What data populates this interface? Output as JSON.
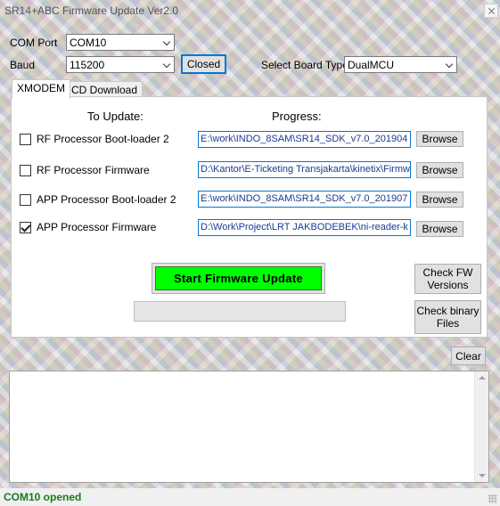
{
  "window": {
    "title": "SR14+ABC Firmware Update Ver2.0"
  },
  "connection": {
    "com_port_label": "COM Port",
    "com_port_value": "COM10",
    "baud_label": "Baud",
    "baud_value": "115200",
    "port_button_label": "Closed",
    "board_type_label": "Select Board Type",
    "board_type_value": "DualMCU"
  },
  "tabs": [
    {
      "label": "XMODEM",
      "active": true
    },
    {
      "label": "CD Download",
      "active": false
    }
  ],
  "columns": {
    "to_update": "To Update:",
    "progress": "Progress:"
  },
  "items": [
    {
      "label": "RF Processor Boot-loader 2",
      "checked": false,
      "path": "E:\\work\\INDO_8SAM\\SR14_SDK_v7.0_201904",
      "browse": "Browse"
    },
    {
      "label": "RF Processor Firmware",
      "checked": false,
      "path": "D:\\Kantor\\E-Ticketing Transjakarta\\kinetix\\Firmw",
      "browse": "Browse"
    },
    {
      "label": "APP Processor Boot-loader 2",
      "checked": false,
      "path": "E:\\work\\INDO_8SAM\\SR14_SDK_v7.0_201907",
      "browse": "Browse"
    },
    {
      "label": "APP Processor Firmware",
      "checked": true,
      "path": "D:\\Work\\Project\\LRT JAKBODEBEK\\ni-reader-k",
      "browse": "Browse"
    }
  ],
  "actions": {
    "start_label": "Start Firmware Update",
    "check_fw_label": "Check FW Versions",
    "check_bin_label": "Check binary Files",
    "clear_label": "Clear"
  },
  "progress": {
    "value": 0
  },
  "log": {
    "text": ""
  },
  "status": {
    "text": "COM10 opened",
    "color": "#1a7a1a"
  },
  "colors": {
    "start_button": "#00ff00",
    "path_text": "#1c3a8f",
    "focus_border": "#0078d7"
  }
}
